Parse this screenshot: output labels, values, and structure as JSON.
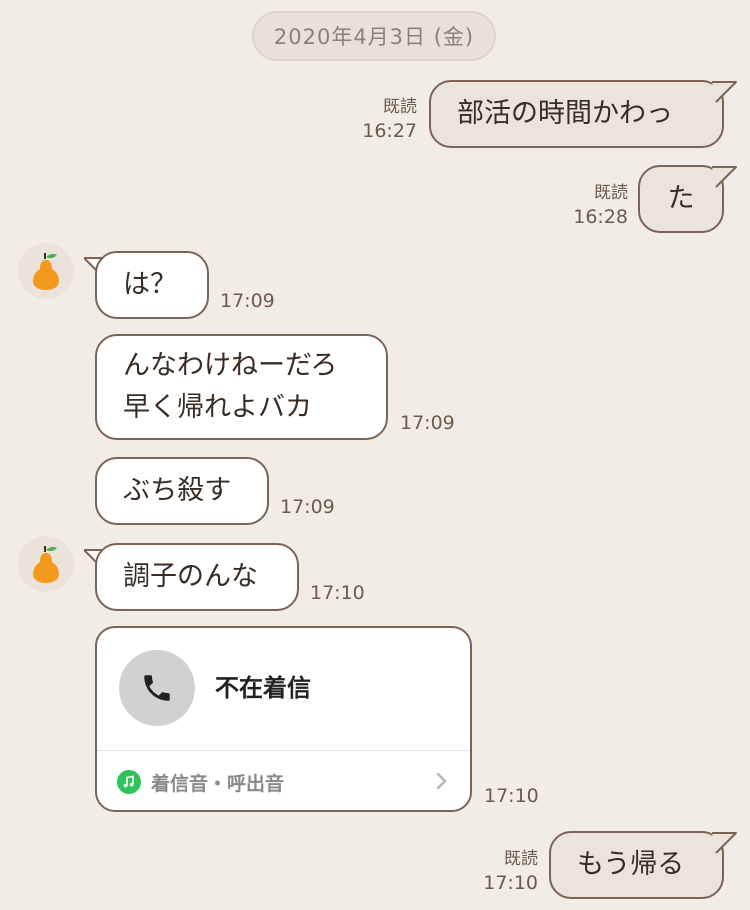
{
  "date_label": "2020年4月3日 (金)",
  "messages": [
    {
      "text": "部活の時間かわっ",
      "read": "既読",
      "time": "16:27"
    },
    {
      "text": "た",
      "read": "既読",
      "time": "16:28"
    },
    {
      "text": "は？",
      "time": "17:09"
    },
    {
      "line1": "んなわけねーだろ",
      "line2": "早く帰れよバカ",
      "time": "17:09"
    },
    {
      "text": "ぶち殺す",
      "time": "17:09"
    },
    {
      "text": "調子のんな",
      "time": "17:10"
    },
    {
      "call_title": "不在着信",
      "ringtone_label": "着信音・呼出音",
      "time": "17:10"
    },
    {
      "text": "もう帰る",
      "read": "既読",
      "time": "17:10"
    }
  ],
  "avatar": {
    "icon": "pear-icon",
    "color": "#f39a1e",
    "leaf_color": "#4caf50"
  },
  "colors": {
    "background": "#f1ece6",
    "bubble_border": "#7b6456",
    "outgoing_bubble": "#ebe4dc",
    "incoming_bubble": "#ffffff",
    "ringtone_green": "#2fc45a"
  }
}
